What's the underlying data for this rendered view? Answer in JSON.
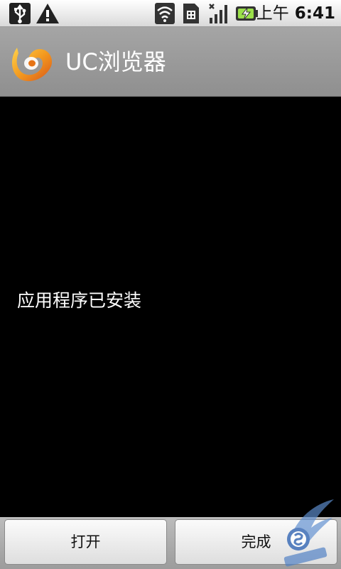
{
  "status_bar": {
    "icons": [
      "usb-icon",
      "warning-icon",
      "wifi-icon",
      "sim-card-icon",
      "signal-icon",
      "battery-charging-icon"
    ],
    "ampm": "上午",
    "time": "6:41"
  },
  "header": {
    "title": "UC浏览器",
    "logo_icon": "uc-browser-logo-icon"
  },
  "content": {
    "message": "应用程序已安装"
  },
  "buttons": {
    "open_label": "打开",
    "done_label": "完成"
  },
  "colors": {
    "status_bar_bg": "#e6e6e6",
    "header_bg": "#9a9a9a",
    "content_bg": "#000000",
    "logo_orange": "#f08a1c"
  }
}
